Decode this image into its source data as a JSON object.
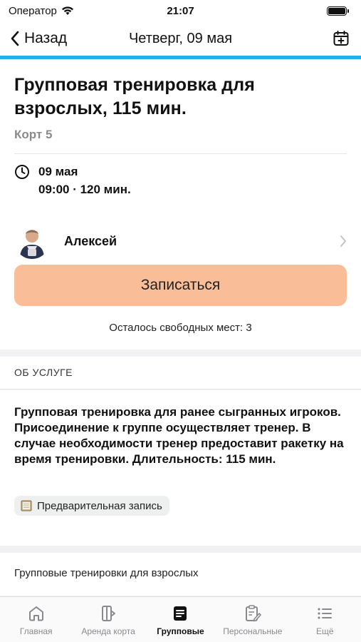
{
  "status": {
    "carrier": "Оператор",
    "time": "21:07"
  },
  "nav": {
    "back_label": "Назад",
    "title": "Четверг, 09 мая"
  },
  "event": {
    "title": "Групповая тренировка для взрослых, 115 мин.",
    "court": "Корт 5",
    "date": "09 мая",
    "time_range": "09:00 · 120 мин."
  },
  "trainer": {
    "name": "Алексей"
  },
  "signup": {
    "button_label": "Записаться",
    "seats_text": "Осталось свободных мест: 3"
  },
  "about": {
    "header": "ОБ УСЛУГЕ",
    "description": "Групповая тренировка для ранее сыгранных игроков. Присоединение к группе осуществляет тренер. В случае необходимости тренер предоставит ракетку на время тренировки. Длительность: 115 мин.",
    "chip_label": "Предварительная запись"
  },
  "category": {
    "label": "Групповые тренировки для взрослых"
  },
  "tabs": [
    {
      "label": "Главная",
      "icon": "home-icon"
    },
    {
      "label": "Аренда корта",
      "icon": "court-rent-icon"
    },
    {
      "label": "Групповые",
      "icon": "group-note-icon"
    },
    {
      "label": "Персональные",
      "icon": "personal-clipboard-icon"
    },
    {
      "label": "Ещё",
      "icon": "more-list-icon"
    }
  ],
  "colors": {
    "accent": "#1ab4e6",
    "button": "#f9bd98"
  }
}
